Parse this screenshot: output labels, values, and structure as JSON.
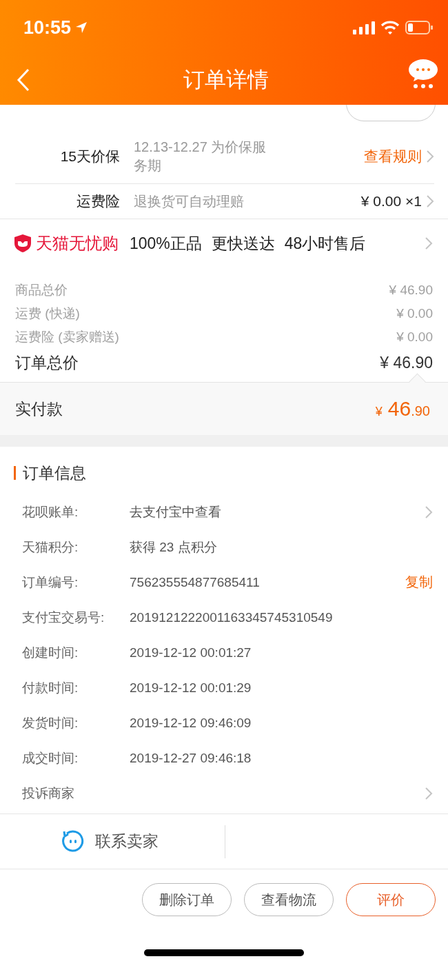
{
  "status_bar": {
    "time": "10:55"
  },
  "nav": {
    "title": "订单详情"
  },
  "services": [
    {
      "label": "15天价保",
      "desc": "12.13-12.27 为价保服务期",
      "action": "查看规则",
      "kind": "link"
    },
    {
      "label": "运费险",
      "desc": "退换货可自动理赔",
      "action": "¥ 0.00 ×1",
      "kind": "amount"
    }
  ],
  "tmall_guarantee": {
    "brand": "天猫无忧购",
    "features": [
      "100%正品",
      "更快送达",
      "48小时售后"
    ]
  },
  "costs": [
    {
      "label": "商品总价",
      "amount": "¥ 46.90",
      "kind": "minor"
    },
    {
      "label": "运费 (快递)",
      "amount": "¥ 0.00",
      "kind": "minor"
    },
    {
      "label": "运费险 (卖家赠送)",
      "amount": "¥ 0.00",
      "kind": "minor"
    },
    {
      "label": "订单总价",
      "amount": "¥ 46.90",
      "kind": "total"
    }
  ],
  "paid": {
    "label": "实付款",
    "currency": "¥",
    "value": "46",
    "fraction": ".90"
  },
  "order_info": {
    "title": "订单信息",
    "rows": [
      {
        "label": "花呗账单:",
        "value": "去支付宝中查看",
        "kind": "link"
      },
      {
        "label": "天猫积分:",
        "value": "获得 23 点积分",
        "kind": "plain"
      },
      {
        "label": "订单编号:",
        "value": "756235554877685411",
        "kind": "copy",
        "action": "复制"
      },
      {
        "label": "支付宝交易号:",
        "value": "2019121222001163345745310549",
        "kind": "plain"
      },
      {
        "label": "创建时间:",
        "value": "2019-12-12 00:01:27",
        "kind": "plain"
      },
      {
        "label": "付款时间:",
        "value": "2019-12-12 00:01:29",
        "kind": "plain"
      },
      {
        "label": "发货时间:",
        "value": "2019-12-12 09:46:09",
        "kind": "plain"
      },
      {
        "label": "成交时间:",
        "value": "2019-12-27 09:46:18",
        "kind": "plain"
      },
      {
        "label": "投诉商家",
        "kind": "link"
      }
    ]
  },
  "contact": {
    "label": "联系卖家"
  },
  "actions": [
    {
      "label": "删除订单",
      "kind": "normal"
    },
    {
      "label": "查看物流",
      "kind": "normal"
    },
    {
      "label": "评价",
      "kind": "primary"
    }
  ]
}
